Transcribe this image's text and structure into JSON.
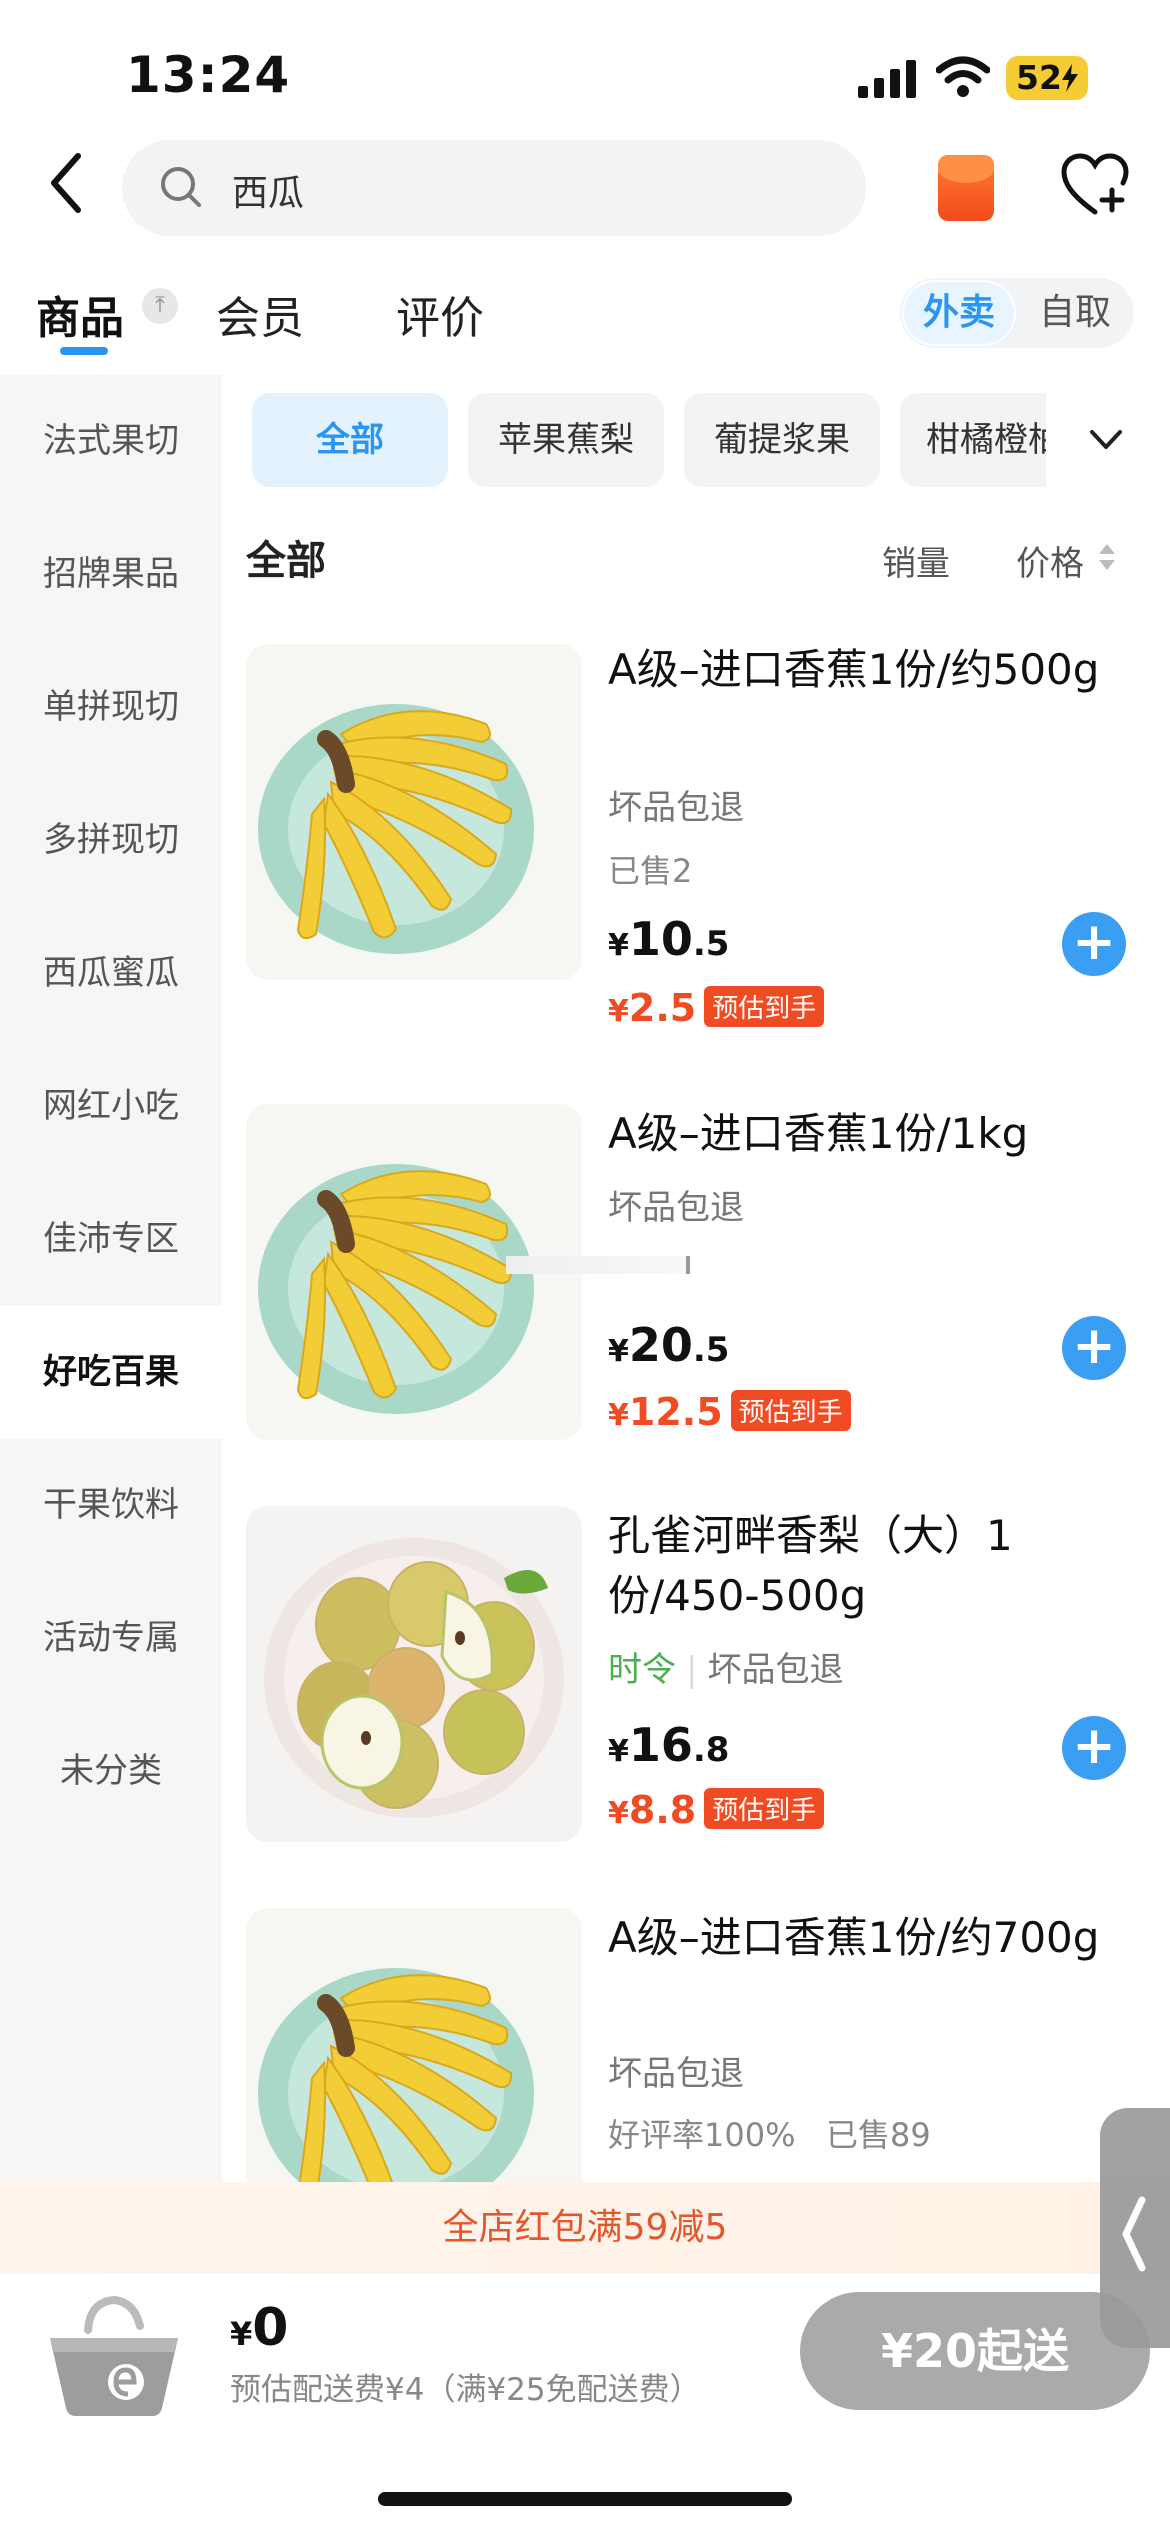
{
  "status_bar": {
    "time": "13:24",
    "battery": "52"
  },
  "header": {
    "search_text": "西瓜"
  },
  "tabs": {
    "goods": "商品",
    "member": "会员",
    "review": "评价"
  },
  "delivery_toggle": {
    "active": "外卖",
    "inactive": "自取"
  },
  "sidebar": {
    "items": [
      "法式果切",
      "招牌果品",
      "单拼现切",
      "多拼现切",
      "西瓜蜜瓜",
      "网红小吃",
      "佳沛专区",
      "好吃百果",
      "干果饮料",
      "活动专属",
      "未分类"
    ]
  },
  "chips": {
    "items": [
      "全部",
      "苹果蕉梨",
      "葡提浆果",
      "柑橘橙柚"
    ]
  },
  "section": {
    "title": "全部",
    "sort_sales": "销量",
    "sort_price": "价格"
  },
  "products": [
    {
      "name": "A级–进口香蕉1份/约500g",
      "tag": "坏品包退",
      "sold": "已售2",
      "currency": "¥",
      "price_int": "10",
      "price_dec": ".5",
      "est_price": "2.5",
      "est_label": "预估到手"
    },
    {
      "name": "A级–进口香蕉1份/1kg",
      "tag": "坏品包退",
      "currency": "¥",
      "price_int": "20",
      "price_dec": ".5",
      "est_price": "12.5",
      "est_label": "预估到手"
    },
    {
      "name": "孔雀河畔香梨（大）1份/450-500g",
      "season": "时令",
      "tag": "坏品包退",
      "currency": "¥",
      "price_int": "16",
      "price_dec": ".8",
      "est_price": "8.8",
      "est_label": "预估到手"
    },
    {
      "name": "A级–进口香蕉1份/约700g",
      "tag": "坏品包退",
      "sold": "好评率100%   已售89"
    }
  ],
  "promo": {
    "text": "全店红包满59减5"
  },
  "cart": {
    "currency": "¥",
    "total": "0",
    "fee": "预估配送费¥4（满¥25免配送费）",
    "min_order": "¥20起送"
  },
  "colors": {
    "accent": "#2b96f2",
    "price_red": "#f04b23",
    "season_green": "#4caf50"
  }
}
